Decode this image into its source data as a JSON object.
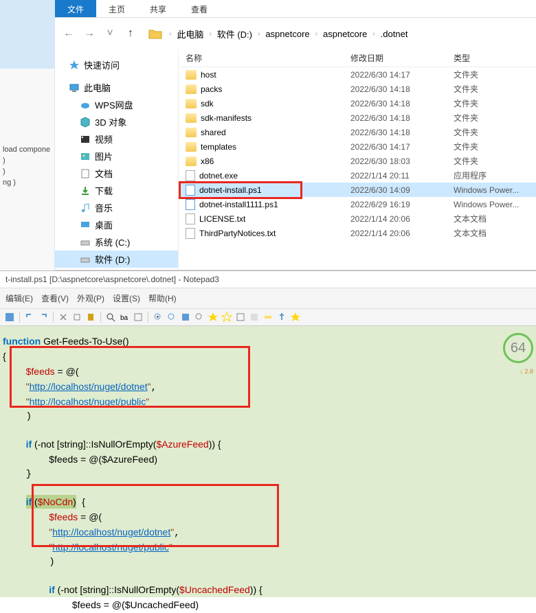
{
  "menu": {
    "file": "文件",
    "home": "主页",
    "share": "共享",
    "view": "查看"
  },
  "breadcrumbs": [
    "此电脑",
    "软件 (D:)",
    "aspnetcore",
    "aspnetcore",
    ".dotnet"
  ],
  "partial_text": "load compone\n)\n)\nng )",
  "tree": {
    "quick": "快速访问",
    "pc": "此电脑",
    "wps": "WPS网盘",
    "threed": "3D 对象",
    "video": "视频",
    "pictures": "图片",
    "docs": "文档",
    "downloads": "下载",
    "music": "音乐",
    "desktop": "桌面",
    "sysc": "系统 (C:)",
    "softd": "软件 (D:)"
  },
  "columns": {
    "name": "名称",
    "date": "修改日期",
    "type": "类型"
  },
  "files": [
    {
      "name": "host",
      "date": "2022/6/30 14:17",
      "type": "文件夹",
      "icon": "folder"
    },
    {
      "name": "packs",
      "date": "2022/6/30 14:18",
      "type": "文件夹",
      "icon": "folder"
    },
    {
      "name": "sdk",
      "date": "2022/6/30 14:18",
      "type": "文件夹",
      "icon": "folder"
    },
    {
      "name": "sdk-manifests",
      "date": "2022/6/30 14:18",
      "type": "文件夹",
      "icon": "folder"
    },
    {
      "name": "shared",
      "date": "2022/6/30 14:18",
      "type": "文件夹",
      "icon": "folder"
    },
    {
      "name": "templates",
      "date": "2022/6/30 14:17",
      "type": "文件夹",
      "icon": "folder"
    },
    {
      "name": "x86",
      "date": "2022/6/30 18:03",
      "type": "文件夹",
      "icon": "folder"
    },
    {
      "name": "dotnet.exe",
      "date": "2022/1/14 20:11",
      "type": "应用程序",
      "icon": "file"
    },
    {
      "name": "dotnet-install.ps1",
      "date": "2022/6/30 14:09",
      "type": "Windows Power...",
      "icon": "ps1",
      "sel": true
    },
    {
      "name": "dotnet-install1111.ps1",
      "date": "2022/6/29 16:19",
      "type": "Windows Power...",
      "icon": "ps1"
    },
    {
      "name": "LICENSE.txt",
      "date": "2022/1/14 20:06",
      "type": "文本文档",
      "icon": "file"
    },
    {
      "name": "ThirdPartyNotices.txt",
      "date": "2022/1/14 20:06",
      "type": "文本文档",
      "icon": "file"
    }
  ],
  "notepad": {
    "title": "t-install.ps1 [D:\\aspnetcore\\aspnetcore\\.dotnet] - Notepad3",
    "menu": [
      "编辑(E)",
      "查看(V)",
      "外观(P)",
      "设置(S)",
      "帮助(H)"
    ],
    "code": {
      "fn": "function",
      "name": " Get-Feeds-To-Use()",
      "feedsvar": "$feeds",
      "at": " = @(",
      "url1": "http://localhost/nuget/dotnet",
      "url2": "http://localhost/nuget/public",
      "if": "if",
      "cond1": " (-not [string]::IsNullOrEmpty(",
      "azure": "$AzureFeed",
      "condend": ")) {",
      "assign2": "$feeds = @($AzureFeed)",
      "nocdn": "$NoCdn",
      "cond3": " (-not [string]::IsNullOrEmpty(",
      "uncached": "$UncachedFeed",
      "last": "$feeds = @($UncachedFeed)"
    },
    "badge": "64",
    "badge_delta": "↓ 2.8"
  }
}
